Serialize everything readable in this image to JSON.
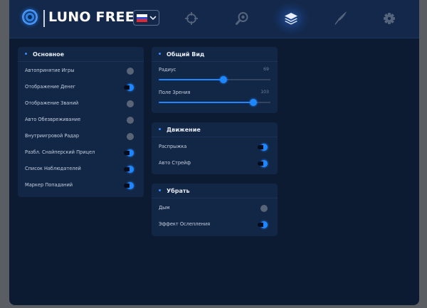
{
  "app": {
    "brand": "LUNO FREE",
    "language_flag": "russia-flag",
    "accent_color": "#1e86ff"
  },
  "nav": [
    {
      "id": "aim",
      "icon": "crosshair-icon"
    },
    {
      "id": "esp",
      "icon": "magnifier-icon"
    },
    {
      "id": "misc",
      "icon": "layers-icon",
      "active": true
    },
    {
      "id": "skins",
      "icon": "knife-icon"
    },
    {
      "id": "settings",
      "icon": "gear-icon"
    }
  ],
  "panels": {
    "main": {
      "title": "Основное",
      "rows": [
        {
          "label": "Автопринятие Игры",
          "on": false
        },
        {
          "label": "Отображение Денег",
          "on": true
        },
        {
          "label": "Отображение Званий",
          "on": false
        },
        {
          "label": "Авто Обезвреживание",
          "on": false
        },
        {
          "label": "Внутриигровой Радар",
          "on": false
        },
        {
          "label": "Разбл. Снайперский Прицел",
          "on": true
        },
        {
          "label": "Список Наблюдателей",
          "on": true
        },
        {
          "label": "Маркер Попаданий",
          "on": true
        }
      ]
    },
    "view": {
      "title": "Общий Вид",
      "sliders": [
        {
          "label": "Радиус",
          "value": "69",
          "fraction": 0.58
        },
        {
          "label": "Поле Зрения",
          "value": "103",
          "fraction": 0.85
        }
      ]
    },
    "movement": {
      "title": "Движение",
      "rows": [
        {
          "label": "Распрыжка",
          "on": true
        },
        {
          "label": "Авто Стрейф",
          "on": true
        }
      ]
    },
    "remove": {
      "title": "Убрать",
      "rows": [
        {
          "label": "Дым",
          "on": false
        },
        {
          "label": "Эффект Ослепления",
          "on": true
        }
      ]
    }
  }
}
